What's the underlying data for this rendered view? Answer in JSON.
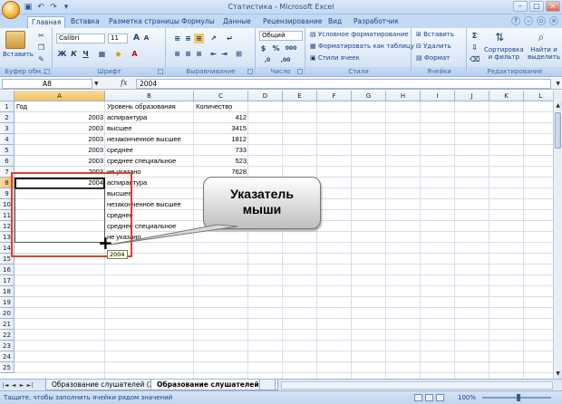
{
  "window": {
    "title": "Статистика - Microsoft Excel"
  },
  "qat": {
    "save_icon": "save-icon",
    "undo_icon": "undo-icon",
    "redo_icon": "redo-icon"
  },
  "tabs": [
    {
      "label": "Главная",
      "active": true
    },
    {
      "label": "Вставка"
    },
    {
      "label": "Разметка страницы"
    },
    {
      "label": "Формулы"
    },
    {
      "label": "Данные"
    },
    {
      "label": "Рецензирование"
    },
    {
      "label": "Вид"
    },
    {
      "label": "Разработчик"
    }
  ],
  "ribbon": {
    "clipboard": {
      "label": "Буфер обм...",
      "paste": "Вставить"
    },
    "font": {
      "label": "Шрифт",
      "name": "Calibri",
      "size": "11",
      "bold": "Ж",
      "italic": "К",
      "underline": "Ч",
      "grow": "A",
      "shrink": "A"
    },
    "alignment": {
      "label": "Выравнивание"
    },
    "number": {
      "label": "Число",
      "format": "Общий",
      "percent": "%",
      "thousands": "000",
      "dec_inc": ",0",
      "dec_dec": ",00"
    },
    "styles": {
      "label": "Стили",
      "conditional": "Условное форматирование",
      "as_table": "Форматировать как таблицу",
      "cell_styles": "Стили ячеек"
    },
    "cells": {
      "label": "Ячейки",
      "insert": "Вставить",
      "delete": "Удалить",
      "format": "Формат"
    },
    "editing": {
      "label": "Редактирование",
      "sort": "Сортировка\nи фильтр",
      "find": "Найти и\nвыделить",
      "sum": "Σ"
    }
  },
  "formula_bar": {
    "name_box": "A8",
    "fx": "fx",
    "value": "2004"
  },
  "columns": [
    "A",
    "B",
    "C",
    "D",
    "E",
    "F",
    "G",
    "H",
    "I",
    "J",
    "K",
    "L"
  ],
  "rows": [
    "1",
    "2",
    "3",
    "4",
    "5",
    "6",
    "7",
    "8",
    "9",
    "10",
    "11",
    "12",
    "13",
    "14",
    "15",
    "16",
    "17",
    "18",
    "19",
    "20",
    "21",
    "22",
    "23",
    "24",
    "25"
  ],
  "cells": {
    "header": {
      "a": "Год",
      "b": "Уровень образования",
      "c": "Количество"
    },
    "data": [
      {
        "a": "2003",
        "b": "аспирантура",
        "c": "412"
      },
      {
        "a": "2003",
        "b": "высшее",
        "c": "3415"
      },
      {
        "a": "2003",
        "b": "незаконченное высшее",
        "c": "1812"
      },
      {
        "a": "2003",
        "b": "среднее",
        "c": "733"
      },
      {
        "a": "2003",
        "b": "среднее специальное",
        "c": "523"
      },
      {
        "a": "2003",
        "b": "не указано",
        "c": "7628"
      },
      {
        "a": "2004",
        "b": "аспирантура",
        "c": ""
      },
      {
        "a": "",
        "b": "высшее",
        "c": ""
      },
      {
        "a": "",
        "b": "незаконченное высшее",
        "c": ""
      },
      {
        "a": "",
        "b": "среднее",
        "c": ""
      },
      {
        "a": "",
        "b": "среднее специальное",
        "c": ""
      },
      {
        "a": "",
        "b": "не указано",
        "c": ""
      }
    ]
  },
  "fill_tooltip": "2004",
  "callout": "Указатель\nмыши",
  "sheets": [
    {
      "label": "Образование слушателей (2)"
    },
    {
      "label": "Образование слушателей (3)",
      "active": true
    }
  ],
  "status": {
    "message": "Тащите, чтобы заполнить ячейки рядом значений",
    "zoom": "100%"
  }
}
